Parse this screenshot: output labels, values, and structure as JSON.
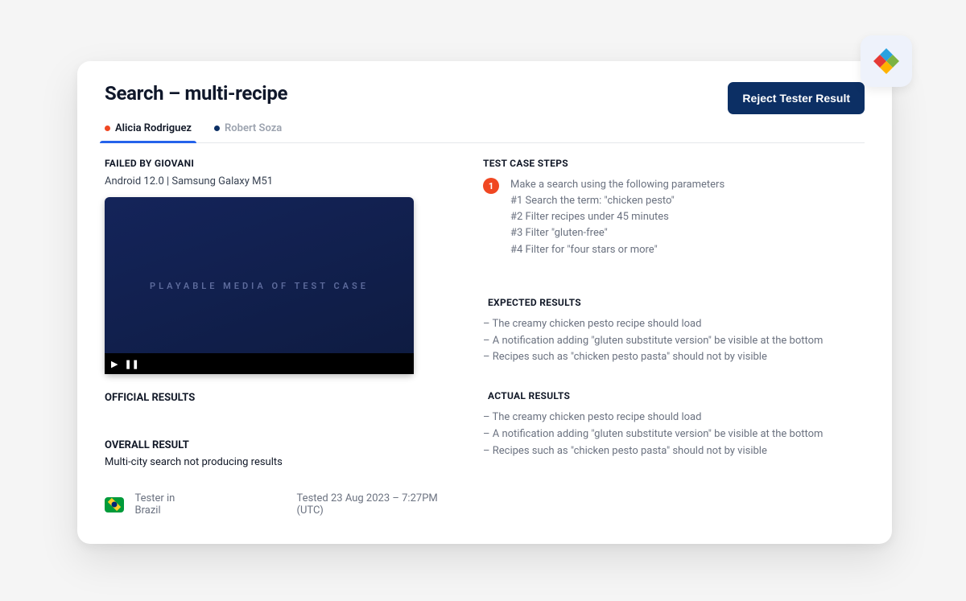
{
  "title": "Search – multi-recipe",
  "reject_button": "Reject Tester Result",
  "tabs": [
    {
      "label": "Alicia Rodriguez",
      "active": true,
      "dot": "orange"
    },
    {
      "label": "Robert Soza",
      "active": false,
      "dot": "navy"
    }
  ],
  "failed_by": "FAILED BY GIOVANI",
  "device_line": "Android 12.0 | Samsung Galaxy M51",
  "media_placeholder": "PLAYABLE MEDIA OF TEST CASE",
  "official_results_label": "OFFICIAL RESULTS",
  "overall_label": "OVERALL RESULT",
  "overall_text": "Multi-city search not producing results",
  "tester_location": "Tester in Brazil",
  "tested_time": "Tested 23 Aug 2023 – 7:27PM (UTC)",
  "steps_label": "TEST CASE STEPS",
  "step1": {
    "num": "1",
    "intro": "Make a search using the following parameters",
    "l1": "#1 Search the term: \"chicken pesto\"",
    "l2": "#2 Filter recipes under 45 minutes",
    "l3": "#3 Filter \"gluten-free\"",
    "l4": "#4 Filter for \"four stars or more\""
  },
  "expected_label": "EXPECTED RESULTS",
  "expected": {
    "l1": "– The creamy chicken pesto recipe should load",
    "l2": "– A notification adding \"gluten substitute version\" be visible at the bottom",
    "l3": "– Recipes such as \"chicken pesto pasta\" should not by visible"
  },
  "actual_label": "ACTUAL RESULTS",
  "actual": {
    "l1": "– The creamy chicken pesto recipe should load",
    "l2": "– A notification adding \"gluten substitute version\" be visible at the bottom",
    "l3": "– Recipes such as \"chicken pesto pasta\" should not by visible"
  }
}
